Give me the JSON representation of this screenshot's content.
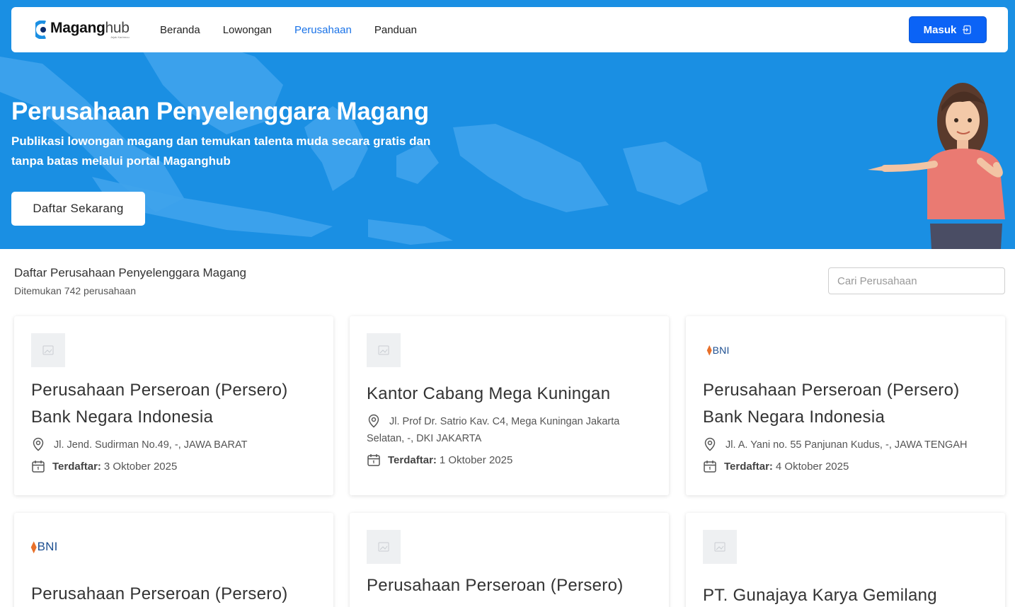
{
  "brand": {
    "name_bold": "Magang",
    "name_light": "hub",
    "tagline": "Jejak Karirmuu"
  },
  "nav": {
    "items": [
      {
        "label": "Beranda",
        "active": false
      },
      {
        "label": "Lowongan",
        "active": false
      },
      {
        "label": "Perusahaan",
        "active": true
      },
      {
        "label": "Panduan",
        "active": false
      }
    ],
    "login_label": "Masuk"
  },
  "hero": {
    "title": "Perusahaan Penyelenggara Magang",
    "subtitle": "Publikasi lowongan magang dan temukan talenta muda secara gratis dan tanpa batas melalui portal Maganghub",
    "cta_label": "Daftar Sekarang"
  },
  "list": {
    "title": "Daftar Perusahaan Penyelenggara Magang",
    "count_text": "Ditemukan 742 perusahaan",
    "search_placeholder": "Cari Perusahaan"
  },
  "registered_label": "Terdaftar:",
  "companies": [
    {
      "logo": "placeholder-image",
      "name": "Perusahaan Perseroan (Persero) Bank Negara Indonesia",
      "address": "Jl. Jend. Sudirman No.49, -, JAWA BARAT",
      "registered": "3 Oktober 2025"
    },
    {
      "logo": "placeholder-image",
      "name": "Kantor Cabang Mega Kuningan",
      "address": "Jl. Prof Dr. Satrio Kav. C4, Mega Kuningan Jakarta Selatan, -, DKI JAKARTA",
      "registered": "1 Oktober 2025"
    },
    {
      "logo": "bni-logo",
      "logo_text": "BNI",
      "name": "Perusahaan Perseroan (Persero) Bank Negara Indonesia",
      "address": "Jl. A. Yani no. 55 Panjunan Kudus, -, JAWA TENGAH",
      "registered": "4 Oktober 2025"
    },
    {
      "logo": "bni-logo",
      "logo_text": "BNI",
      "name": "Perusahaan Perseroan (Persero)"
    },
    {
      "logo": "placeholder-image",
      "name": "Perusahaan Perseroan (Persero)"
    },
    {
      "logo": "placeholder-image",
      "name": "PT. Gunajaya Karya Gemilang"
    }
  ],
  "colors": {
    "hero_bg": "#1a8fe3",
    "primary": "#0b63f6",
    "active_nav": "#1a73e8"
  }
}
